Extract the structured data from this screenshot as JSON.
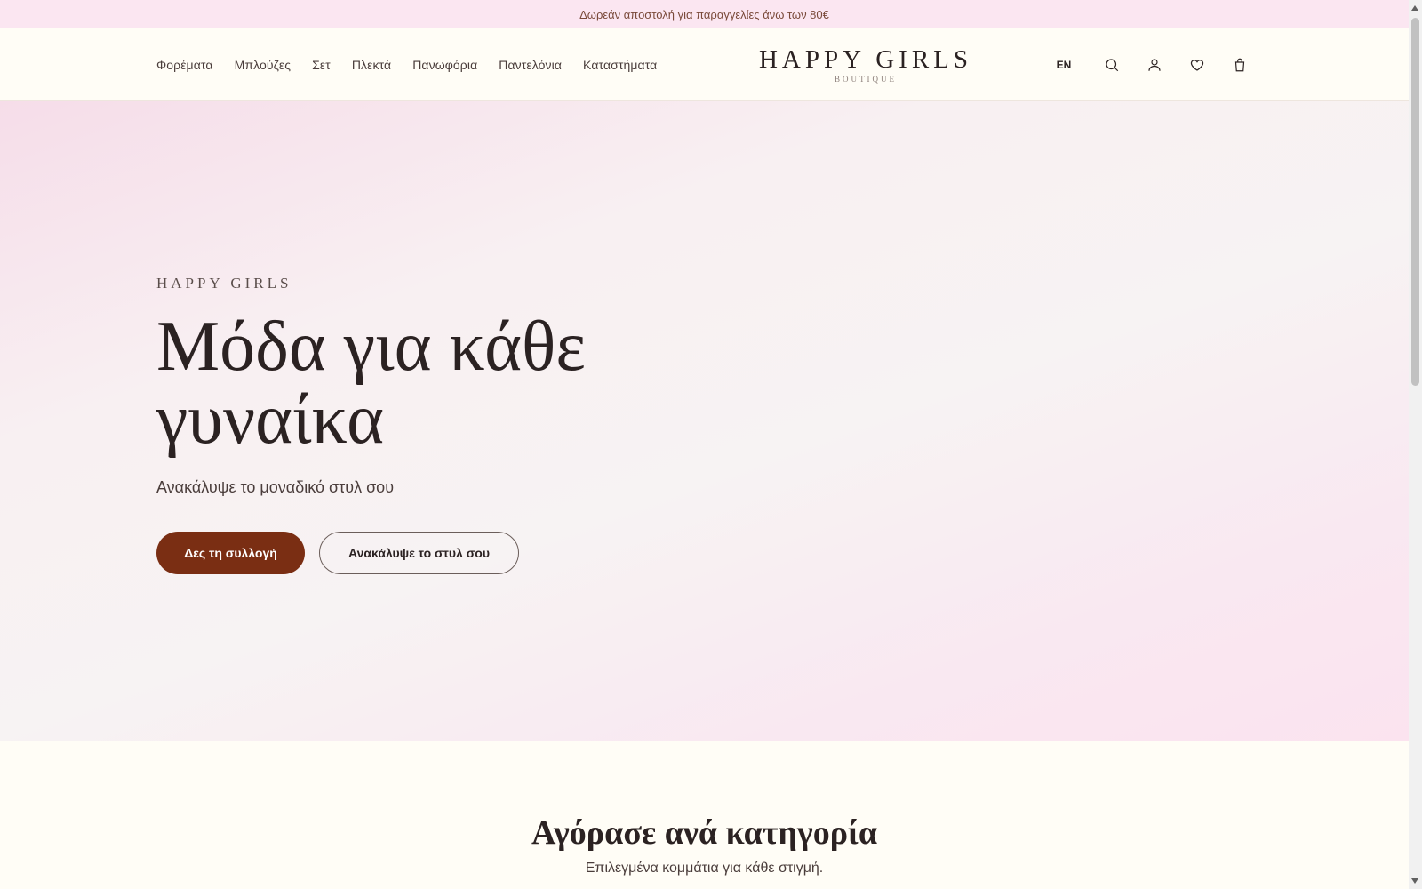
{
  "announcement": "Δωρεάν αποστολή για παραγγελίες άνω των 80€",
  "nav": {
    "items": [
      {
        "label": "Φορέματα"
      },
      {
        "label": "Μπλούζες"
      },
      {
        "label": "Σετ"
      },
      {
        "label": "Πλεκτά"
      },
      {
        "label": "Πανωφόρια"
      },
      {
        "label": "Παντελόνια"
      },
      {
        "label": "Καταστήματα"
      }
    ]
  },
  "logo": {
    "main": "HAPPY GIRLS",
    "sub": "BOUTIQUE"
  },
  "actions": {
    "lang": "EN",
    "icons": [
      "search-icon",
      "account-icon",
      "heart-icon",
      "bag-icon"
    ]
  },
  "hero": {
    "eyebrow": "HAPPY GIRLS",
    "title_line1": "Μόδα για κάθε",
    "title_line2": "γυναίκα",
    "subtitle": "Ανακάλυψε το μοναδικό στυλ σου",
    "primary_cta": "Δες τη συλλογή",
    "secondary_cta": "Ανακάλυψε το στυλ σου"
  },
  "categories": {
    "title": "Αγόρασε ανά κατηγορία",
    "subtitle": "Επιλεγμένα κομμάτια για κάθε στιγμή."
  },
  "colors": {
    "accent": "#7a2e13",
    "announce_bg": "#fbe6f1",
    "page_bg": "#fffdf6"
  }
}
